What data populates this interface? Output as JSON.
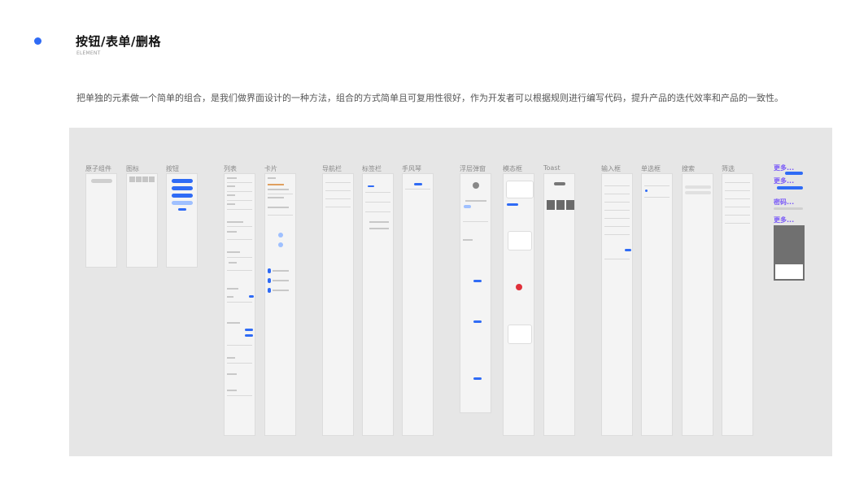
{
  "header": {
    "title": "按钮/表单/删格",
    "subtitle": "ELEMENT",
    "description": "把单独的元素做一个简单的组合，是我们做界面设计的一种方法，组合的方式简单且可复用性很好，作为开发者可以根据规则进行编写代码，提升产品的迭代效率和产品的一致性。"
  },
  "columns": [
    {
      "label": "原子组件"
    },
    {
      "label": "图标"
    },
    {
      "label": "按钮"
    },
    {
      "label": "列表"
    },
    {
      "label": "卡片"
    },
    {
      "label": "导航栏"
    },
    {
      "label": "标签栏"
    },
    {
      "label": "手风琴"
    },
    {
      "label": "浮层弹窗"
    },
    {
      "label": "模态框"
    },
    {
      "label": "Toast"
    },
    {
      "label": "输入框"
    },
    {
      "label": "单选框"
    },
    {
      "label": "搜索"
    },
    {
      "label": "筛选"
    }
  ],
  "extras": {
    "items": [
      "更多...",
      "更多...",
      "密码...",
      "更多..."
    ]
  },
  "colors": {
    "accent": "#2f6bf5",
    "purple": "#7a5af8",
    "board": "#e6e6e6"
  }
}
